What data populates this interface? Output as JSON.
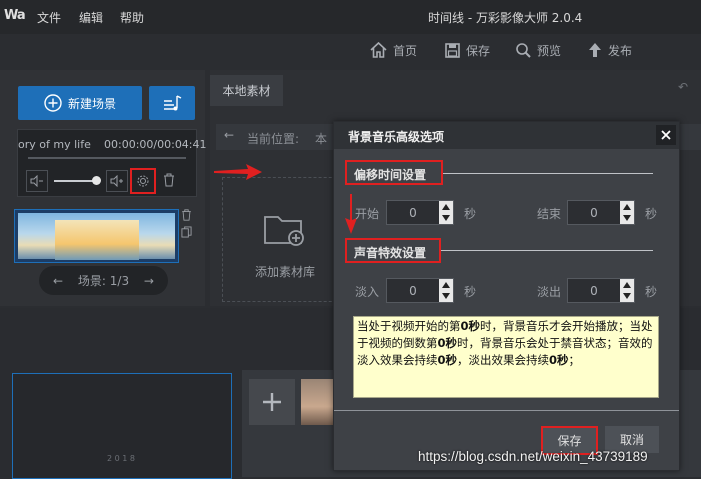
{
  "app": {
    "logo": "Wa",
    "window_title": "时间线 - 万彩影像大师 2.0.4"
  },
  "menu": {
    "file": "文件",
    "edit": "编辑",
    "help": "帮助"
  },
  "toolbar": {
    "home": "首页",
    "save": "保存",
    "preview": "预览",
    "publish": "发布"
  },
  "left": {
    "new_scene": "新建场景",
    "track_name": "ory of my life",
    "time": "00:00:00/00:04:41",
    "scene_label": "场景: 1/3"
  },
  "library": {
    "tab": "本地素材",
    "current_location_label": "当前位置:",
    "current_location_value": "本",
    "add_library": "添加素材库"
  },
  "timeline": {
    "thumb_text": "2 0 1 8"
  },
  "modal": {
    "title": "背景音乐高级选项",
    "offset_section": "偏移时间设置",
    "start_label": "开始",
    "start_value": "0",
    "end_label": "结束",
    "end_value": "0",
    "unit": "秒",
    "effect_section": "声音特效设置",
    "fadein_label": "淡入",
    "fadein_value": "0",
    "fadeout_label": "淡出",
    "fadeout_value": "0",
    "note_parts": [
      "当处于视频开始的第",
      "0秒",
      "时，背景音乐才会开始播放；当处于视频的倒数第",
      "0秒",
      "时，背景音乐会处于禁音状态；音效的淡入效果会持续",
      "0秒",
      "，淡出效果会持续",
      "0秒",
      "；"
    ],
    "save": "保存",
    "cancel": "取消"
  },
  "watermark": "https://blog.csdn.net/weixin_43739189",
  "colors": {
    "accent": "#1e6fb8",
    "annotation": "#e02020",
    "note_bg": "#ffffcc"
  }
}
